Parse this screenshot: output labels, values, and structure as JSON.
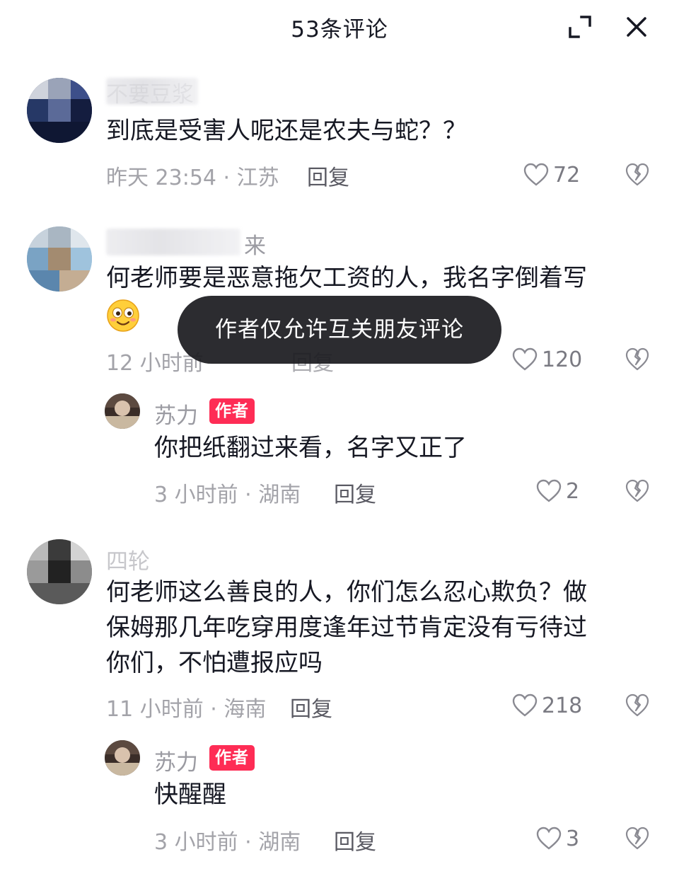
{
  "header": {
    "title": "53条评论",
    "expand_icon": "expand-icon",
    "close_icon": "close-icon"
  },
  "comments": [
    {
      "username": "不要豆浆",
      "text_lines": [
        "到底是受害人呢还是农夫与蛇？？"
      ],
      "meta": "昨天 23:54 · 江苏",
      "reply_label": "回复",
      "likes": "72"
    },
    {
      "username": "来",
      "text_lines": [
        "何老师要是恶意拖欠工资的人，我名字倒着写"
      ],
      "emoji": "smiling-face-emoji",
      "meta": "12 小时前",
      "reply_label": "回复",
      "likes": "120",
      "replies": [
        {
          "username": "苏力",
          "badge": "作者",
          "text_lines": [
            "你把纸翻过来看，名字又正了"
          ],
          "meta": "3 小时前 · 湖南",
          "reply_label": "回复",
          "likes": "2"
        }
      ]
    },
    {
      "username": "四轮",
      "text_lines": [
        "何老师这么善良的人，你们怎么忍心欺负？做",
        "保姆那几年吃穿用度逢年过节肯定没有亏待过",
        "你们，不怕遭报应吗"
      ],
      "meta": "11 小时前 · 海南",
      "reply_label": "回复",
      "likes": "218",
      "replies": [
        {
          "username": "苏力",
          "badge": "作者",
          "text_lines": [
            "快醒醒"
          ],
          "meta": "3 小时前 · 湖南",
          "reply_label": "回复",
          "likes": "3"
        }
      ]
    }
  ],
  "toast": {
    "text": "作者仅允许互关朋友评论"
  },
  "colors": {
    "badge": "#fe2c55",
    "text": "#161823",
    "meta": "#a3a3a9"
  }
}
